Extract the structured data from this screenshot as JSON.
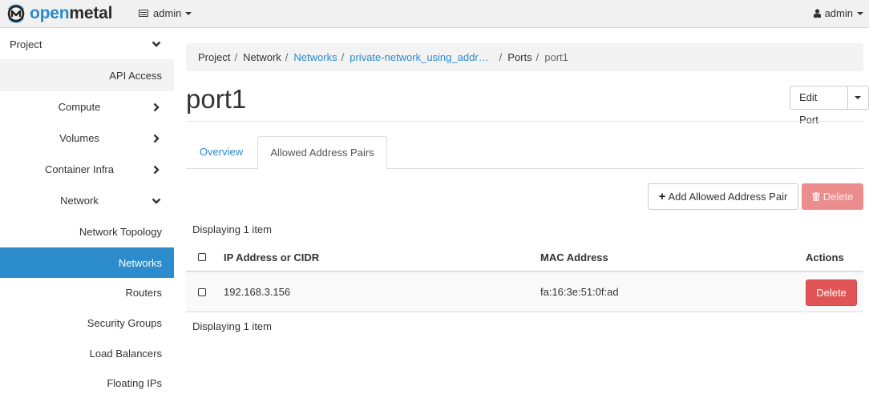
{
  "navbar": {
    "brand_open": "open",
    "brand_metal": "metal",
    "project_selector": "admin",
    "user_menu": "admin"
  },
  "sidebar": {
    "project": "Project",
    "items": [
      {
        "label": "API Access"
      },
      {
        "label": "Compute"
      },
      {
        "label": "Volumes"
      },
      {
        "label": "Container Infra"
      },
      {
        "label": "Network"
      },
      {
        "label": "Network Topology"
      },
      {
        "label": "Networks",
        "active": true
      },
      {
        "label": "Routers"
      },
      {
        "label": "Security Groups"
      },
      {
        "label": "Load Balancers"
      },
      {
        "label": "Floating IPs"
      }
    ]
  },
  "breadcrumb": [
    "Project",
    "Network",
    "Networks",
    "private-network_using_addr…",
    "Ports",
    "port1"
  ],
  "page": {
    "title": "port1",
    "edit_button": "Edit Port"
  },
  "tabs": [
    "Overview",
    "Allowed Address Pairs"
  ],
  "actions": {
    "add": "Add Allowed Address Pair",
    "delete": "Delete"
  },
  "table": {
    "count_text": "Displaying 1 item",
    "columns": [
      "IP Address or CIDR",
      "MAC Address",
      "Actions"
    ],
    "rows": [
      {
        "ip": "192.168.3.156",
        "mac": "fa:16:3e:51:0f:ad",
        "action": "Delete"
      }
    ]
  },
  "colors": {
    "accent": "#2d8ccb",
    "danger": "#e05656",
    "danger_disabled": "#eb8d8d"
  }
}
